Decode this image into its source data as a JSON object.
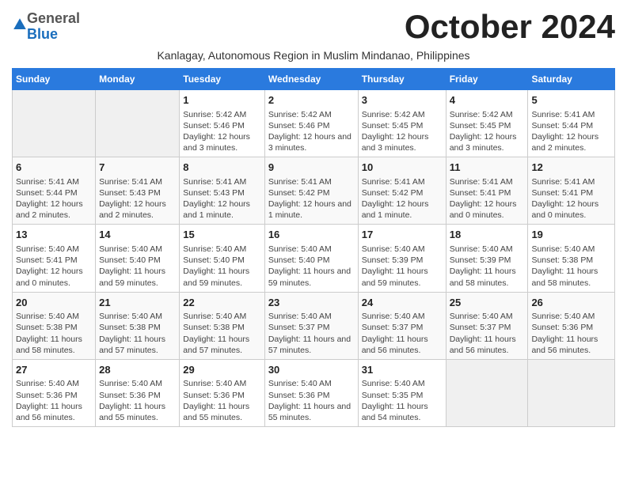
{
  "logo": {
    "general": "General",
    "blue": "Blue"
  },
  "title": "October 2024",
  "subtitle": "Kanlagay, Autonomous Region in Muslim Mindanao, Philippines",
  "headers": [
    "Sunday",
    "Monday",
    "Tuesday",
    "Wednesday",
    "Thursday",
    "Friday",
    "Saturday"
  ],
  "weeks": [
    [
      {
        "day": "",
        "info": ""
      },
      {
        "day": "",
        "info": ""
      },
      {
        "day": "1",
        "info": "Sunrise: 5:42 AM\nSunset: 5:46 PM\nDaylight: 12 hours and 3 minutes."
      },
      {
        "day": "2",
        "info": "Sunrise: 5:42 AM\nSunset: 5:46 PM\nDaylight: 12 hours and 3 minutes."
      },
      {
        "day": "3",
        "info": "Sunrise: 5:42 AM\nSunset: 5:45 PM\nDaylight: 12 hours and 3 minutes."
      },
      {
        "day": "4",
        "info": "Sunrise: 5:42 AM\nSunset: 5:45 PM\nDaylight: 12 hours and 3 minutes."
      },
      {
        "day": "5",
        "info": "Sunrise: 5:41 AM\nSunset: 5:44 PM\nDaylight: 12 hours and 2 minutes."
      }
    ],
    [
      {
        "day": "6",
        "info": "Sunrise: 5:41 AM\nSunset: 5:44 PM\nDaylight: 12 hours and 2 minutes."
      },
      {
        "day": "7",
        "info": "Sunrise: 5:41 AM\nSunset: 5:43 PM\nDaylight: 12 hours and 2 minutes."
      },
      {
        "day": "8",
        "info": "Sunrise: 5:41 AM\nSunset: 5:43 PM\nDaylight: 12 hours and 1 minute."
      },
      {
        "day": "9",
        "info": "Sunrise: 5:41 AM\nSunset: 5:42 PM\nDaylight: 12 hours and 1 minute."
      },
      {
        "day": "10",
        "info": "Sunrise: 5:41 AM\nSunset: 5:42 PM\nDaylight: 12 hours and 1 minute."
      },
      {
        "day": "11",
        "info": "Sunrise: 5:41 AM\nSunset: 5:41 PM\nDaylight: 12 hours and 0 minutes."
      },
      {
        "day": "12",
        "info": "Sunrise: 5:41 AM\nSunset: 5:41 PM\nDaylight: 12 hours and 0 minutes."
      }
    ],
    [
      {
        "day": "13",
        "info": "Sunrise: 5:40 AM\nSunset: 5:41 PM\nDaylight: 12 hours and 0 minutes."
      },
      {
        "day": "14",
        "info": "Sunrise: 5:40 AM\nSunset: 5:40 PM\nDaylight: 11 hours and 59 minutes."
      },
      {
        "day": "15",
        "info": "Sunrise: 5:40 AM\nSunset: 5:40 PM\nDaylight: 11 hours and 59 minutes."
      },
      {
        "day": "16",
        "info": "Sunrise: 5:40 AM\nSunset: 5:40 PM\nDaylight: 11 hours and 59 minutes."
      },
      {
        "day": "17",
        "info": "Sunrise: 5:40 AM\nSunset: 5:39 PM\nDaylight: 11 hours and 59 minutes."
      },
      {
        "day": "18",
        "info": "Sunrise: 5:40 AM\nSunset: 5:39 PM\nDaylight: 11 hours and 58 minutes."
      },
      {
        "day": "19",
        "info": "Sunrise: 5:40 AM\nSunset: 5:38 PM\nDaylight: 11 hours and 58 minutes."
      }
    ],
    [
      {
        "day": "20",
        "info": "Sunrise: 5:40 AM\nSunset: 5:38 PM\nDaylight: 11 hours and 58 minutes."
      },
      {
        "day": "21",
        "info": "Sunrise: 5:40 AM\nSunset: 5:38 PM\nDaylight: 11 hours and 57 minutes."
      },
      {
        "day": "22",
        "info": "Sunrise: 5:40 AM\nSunset: 5:38 PM\nDaylight: 11 hours and 57 minutes."
      },
      {
        "day": "23",
        "info": "Sunrise: 5:40 AM\nSunset: 5:37 PM\nDaylight: 11 hours and 57 minutes."
      },
      {
        "day": "24",
        "info": "Sunrise: 5:40 AM\nSunset: 5:37 PM\nDaylight: 11 hours and 56 minutes."
      },
      {
        "day": "25",
        "info": "Sunrise: 5:40 AM\nSunset: 5:37 PM\nDaylight: 11 hours and 56 minutes."
      },
      {
        "day": "26",
        "info": "Sunrise: 5:40 AM\nSunset: 5:36 PM\nDaylight: 11 hours and 56 minutes."
      }
    ],
    [
      {
        "day": "27",
        "info": "Sunrise: 5:40 AM\nSunset: 5:36 PM\nDaylight: 11 hours and 56 minutes."
      },
      {
        "day": "28",
        "info": "Sunrise: 5:40 AM\nSunset: 5:36 PM\nDaylight: 11 hours and 55 minutes."
      },
      {
        "day": "29",
        "info": "Sunrise: 5:40 AM\nSunset: 5:36 PM\nDaylight: 11 hours and 55 minutes."
      },
      {
        "day": "30",
        "info": "Sunrise: 5:40 AM\nSunset: 5:36 PM\nDaylight: 11 hours and 55 minutes."
      },
      {
        "day": "31",
        "info": "Sunrise: 5:40 AM\nSunset: 5:35 PM\nDaylight: 11 hours and 54 minutes."
      },
      {
        "day": "",
        "info": ""
      },
      {
        "day": "",
        "info": ""
      }
    ]
  ]
}
